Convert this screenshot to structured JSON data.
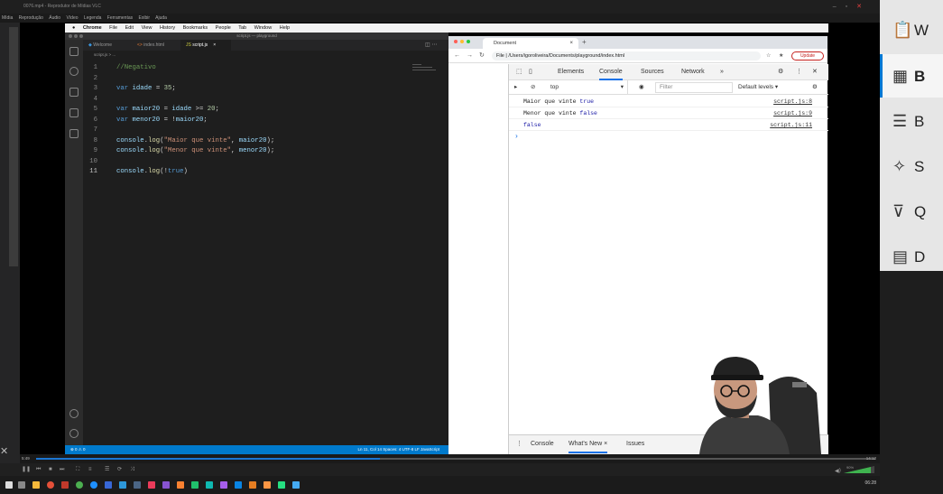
{
  "vlc": {
    "title": "0076.mp4 - Reprodutor de Mídias VLC",
    "menu": [
      "Mídia",
      "Reprodução",
      "Áudio",
      "Vídeo",
      "Legenda",
      "Ferramentas",
      "Exibir",
      "Ajuda"
    ],
    "time_elapsed": "5:49",
    "time_total": "14:12",
    "volume": "90%",
    "progress": 0.41
  },
  "mac_menubar": {
    "app": "Chrome",
    "items": [
      "File",
      "Edit",
      "View",
      "History",
      "Bookmarks",
      "People",
      "Tab",
      "Window",
      "Help"
    ]
  },
  "vscode": {
    "window_title": "script.js — playground",
    "tabs": [
      {
        "label": "Welcome",
        "active": false
      },
      {
        "label": "index.html",
        "active": false
      },
      {
        "label": "script.js",
        "active": true
      }
    ],
    "breadcrumb": "script.js > ...",
    "code_lines": [
      {
        "n": "1",
        "text": "//Negativo"
      },
      {
        "n": "2",
        "text": ""
      },
      {
        "n": "3",
        "text": "var idade = 35;"
      },
      {
        "n": "4",
        "text": ""
      },
      {
        "n": "5",
        "text": "var maior20 = idade >= 20;"
      },
      {
        "n": "6",
        "text": "var menor20 = !maior20;"
      },
      {
        "n": "7",
        "text": ""
      },
      {
        "n": "8",
        "text": "console.log(\"Maior que vinte\", maior20);"
      },
      {
        "n": "9",
        "text": "console.log(\"Menor que vinte\", menor20);"
      },
      {
        "n": "10",
        "text": ""
      },
      {
        "n": "11",
        "text": "console.log(!true)"
      }
    ],
    "status_left": "⊗ 0 ⚠ 0",
    "status_right": "Ln 11, Col 14   Spaces: 4   UTF-8   LF   JavaScript"
  },
  "chrome": {
    "tab_title": "Document",
    "url": "File  |  /Users/igoroliveira/Documents/playground/index.html",
    "update_label": "Update",
    "devtools": {
      "tabs": [
        "Elements",
        "Console",
        "Sources",
        "Network"
      ],
      "more": "»",
      "context": "top",
      "filter_placeholder": "Filter",
      "levels": "Default levels ▾",
      "messages": [
        {
          "text": "Maior que vinte",
          "value": "true",
          "source": "script.js:8"
        },
        {
          "text": "Menor que vinte",
          "value": "false",
          "source": "script.js:9"
        },
        {
          "text": "",
          "value": "false",
          "source": "script.js:11"
        }
      ],
      "prompt": "›",
      "drawer_tabs": [
        "Console",
        "What's New",
        "Issues"
      ]
    }
  },
  "right_panel": {
    "items": [
      {
        "icon": "clipboard-icon",
        "label": "W"
      },
      {
        "icon": "dashboard-icon",
        "label": "B"
      },
      {
        "icon": "layers-icon",
        "label": "B"
      },
      {
        "icon": "sparkle-icon",
        "label": "S"
      },
      {
        "icon": "filter-icon",
        "label": "Q"
      },
      {
        "icon": "calendar-icon",
        "label": "D"
      }
    ]
  },
  "taskbar": {
    "clock": "06:28"
  },
  "colors": {
    "accent": "#007acc",
    "devtools_blue": "#1a73e8",
    "vlc_progress": "#1c76d2"
  }
}
